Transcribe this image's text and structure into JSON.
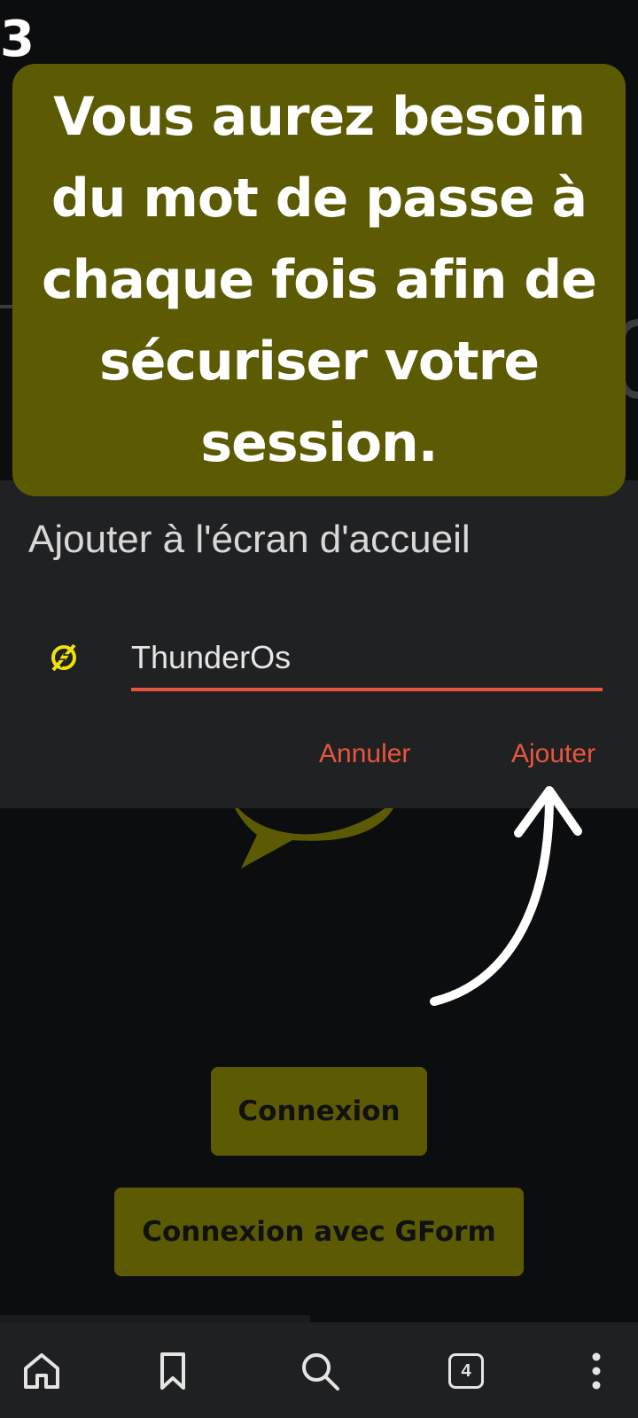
{
  "step": {
    "number": "3"
  },
  "caption": {
    "text": "Vous aurez besoin du mot de passe à chaque fois afin de sécuriser votre session."
  },
  "dialog": {
    "title": "Ajouter à l'écran d'accueil",
    "input_value": "ThunderOs",
    "cancel_label": "Annuler",
    "add_label": "Ajouter"
  },
  "page": {
    "connexion_label": "Connexion",
    "connexion_gform_label": "Connexion avec GForm"
  },
  "bottom_nav": {
    "tabs_count": "4",
    "items": [
      "home-icon",
      "bookmark-icon",
      "search-icon",
      "tabs-icon",
      "more-icon"
    ]
  },
  "colors": {
    "accent": "#e8553d",
    "caption_bg": "#5d5a04",
    "dialog_bg": "#202123",
    "page_bg": "#0c0d0f",
    "app_icon": "#f2e20a"
  }
}
